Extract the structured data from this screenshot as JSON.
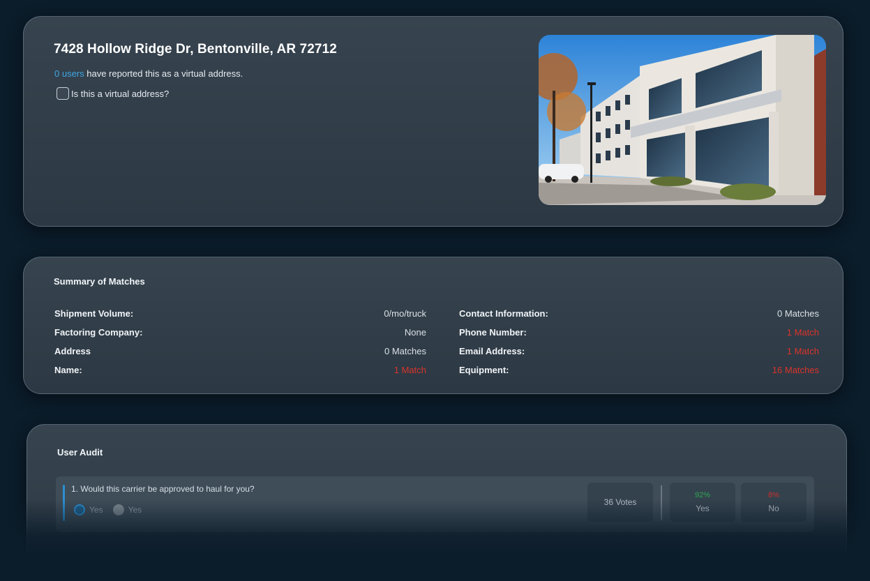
{
  "address_card": {
    "title": "7428 Hollow Ridge Dr, Bentonville, AR 72712",
    "report_count_link": "0 users",
    "report_text": " have reported this as a virtual address.",
    "virtual_checkbox_label": "Is this a virtual address?",
    "virtual_checked": false,
    "photo_icon": "building-photo"
  },
  "summary": {
    "title": "Summary of Matches",
    "left": [
      {
        "label": "Shipment Volume:",
        "value": "0/mo/truck",
        "alert": false
      },
      {
        "label": "Factoring Company:",
        "value": "None",
        "alert": false
      },
      {
        "label": "Address",
        "value": "0 Matches",
        "alert": false
      },
      {
        "label": "Name:",
        "value": "1 Match",
        "alert": true
      }
    ],
    "right": [
      {
        "label": "Contact Information:",
        "value": "0 Matches",
        "alert": false
      },
      {
        "label": "Phone Number:",
        "value": "1 Match",
        "alert": true
      },
      {
        "label": "Email Address:",
        "value": "1 Match",
        "alert": true
      },
      {
        "label": "Equipment:",
        "value": "16 Matches",
        "alert": true
      }
    ]
  },
  "audit": {
    "title": "User Audit",
    "question": "1. Would this carrier be approved to haul for you?",
    "options": [
      {
        "label": "Yes",
        "selected": true
      },
      {
        "label": "Yes",
        "selected": false
      }
    ],
    "votes": "36 Votes",
    "yes_pct": "92%",
    "yes_label": "Yes",
    "no_pct": "8%",
    "no_label": "No"
  },
  "colors": {
    "background": "#0b1c2a",
    "link": "#3fa6e6",
    "alert": "#d9342c",
    "positive": "#2fa84f",
    "accent": "#2c8fd1"
  }
}
